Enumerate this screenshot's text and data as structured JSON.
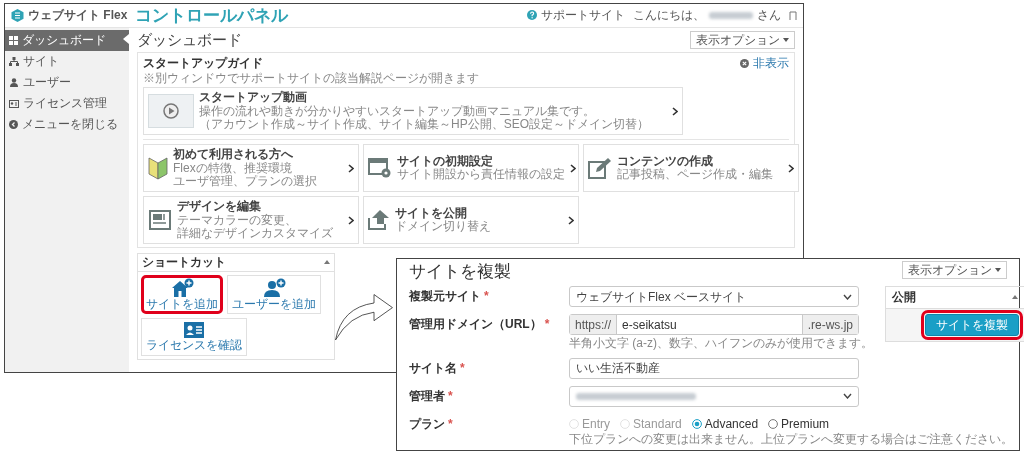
{
  "control_panel": {
    "logo_text": "ウェブサイト Flex",
    "title": "コントロールパネル",
    "support_link": "サポートサイト",
    "greeting": "こんにちは、",
    "user_redacted": true,
    "greeting_suffix": "さん",
    "sidebar": [
      {
        "kind": "dashboard",
        "label": "ダッシュボード",
        "selected": true
      },
      {
        "kind": "site",
        "label": "サイト",
        "selected": false
      },
      {
        "kind": "user",
        "label": "ユーザー",
        "selected": false
      },
      {
        "kind": "license",
        "label": "ライセンス管理",
        "selected": false
      },
      {
        "kind": "collapse",
        "label": "メニューを閉じる",
        "selected": false
      }
    ],
    "page_title": "ダッシュボード",
    "display_options": "表示オプション",
    "startup_guide": {
      "title": "スタートアップガイド",
      "note": "※別ウィンドウでサポートサイトの該当解説ページが開きます",
      "hide_link": "非表示",
      "video": {
        "title": "スタートアップ動画",
        "description": [
          "操作の流れや動きが分かりやすいスタートアップ動画マニュアル集です。",
          "（アカウント作成～サイト作成、サイト編集～HP公開、SEO設定～ドメイン切替）"
        ]
      },
      "cards": [
        {
          "kind": "beginner",
          "title": "初めて利用される方へ",
          "description": [
            "Flexの特徴、推奨環境",
            "ユーザ管理、プランの選択"
          ]
        },
        {
          "kind": "settings",
          "title": "サイトの初期設定",
          "description": [
            "サイト開設から責任情報の設定"
          ]
        },
        {
          "kind": "content",
          "title": "コンテンツの作成",
          "description": [
            "記事投稿、ページ作成・編集"
          ]
        },
        {
          "kind": "design",
          "title": "デザインを編集",
          "description": [
            "テーマカラーの変更、",
            "詳細なデザインカスタマイズ"
          ]
        },
        {
          "kind": "publish",
          "title": "サイトを公開",
          "description": [
            "ドメイン切り替え"
          ]
        }
      ]
    },
    "shortcuts": {
      "title": "ショートカット",
      "items": [
        {
          "kind": "add_site",
          "label": "サイトを追加",
          "highlighted": true
        },
        {
          "kind": "add_user",
          "label": "ユーザーを追加",
          "highlighted": false
        },
        {
          "kind": "license",
          "label": "ライセンスを確認",
          "highlighted": false
        }
      ]
    }
  },
  "clone_dialog": {
    "title": "サイトを複製",
    "display_options": "表示オプション",
    "fields": [
      {
        "kind": "select",
        "label": "複製元サイト",
        "required_mark": "*",
        "value": "ウェブサイトFlex ベースサイト",
        "redacted": false
      },
      {
        "kind": "domain",
        "label": "管理用ドメイン（URL）",
        "required_mark": "*",
        "prefix": "https://",
        "value": "e-seikatsu",
        "suffix": ".re-ws.jp",
        "help": "半角小文字 (a-z)、数字、ハイフンのみが使用できます。"
      },
      {
        "kind": "text",
        "label": "サイト名",
        "required_mark": "*",
        "value": "いい生活不動産"
      },
      {
        "kind": "select",
        "label": "管理者",
        "required_mark": "*",
        "redacted": true
      },
      {
        "kind": "radio",
        "label": "プラン",
        "required_mark": "*",
        "options": [
          {
            "label": "Entry",
            "selected": false,
            "disabled": true
          },
          {
            "label": "Standard",
            "selected": false,
            "disabled": true
          },
          {
            "label": "Advanced",
            "selected": true,
            "disabled": false
          },
          {
            "label": "Premium",
            "selected": false,
            "disabled": false
          }
        ],
        "help": "下位プランへの変更は出来ません。上位プランへ変更する場合はご注意ください。"
      }
    ],
    "publish": {
      "title": "公開",
      "button": "サイトを複製",
      "highlighted": true
    }
  }
}
